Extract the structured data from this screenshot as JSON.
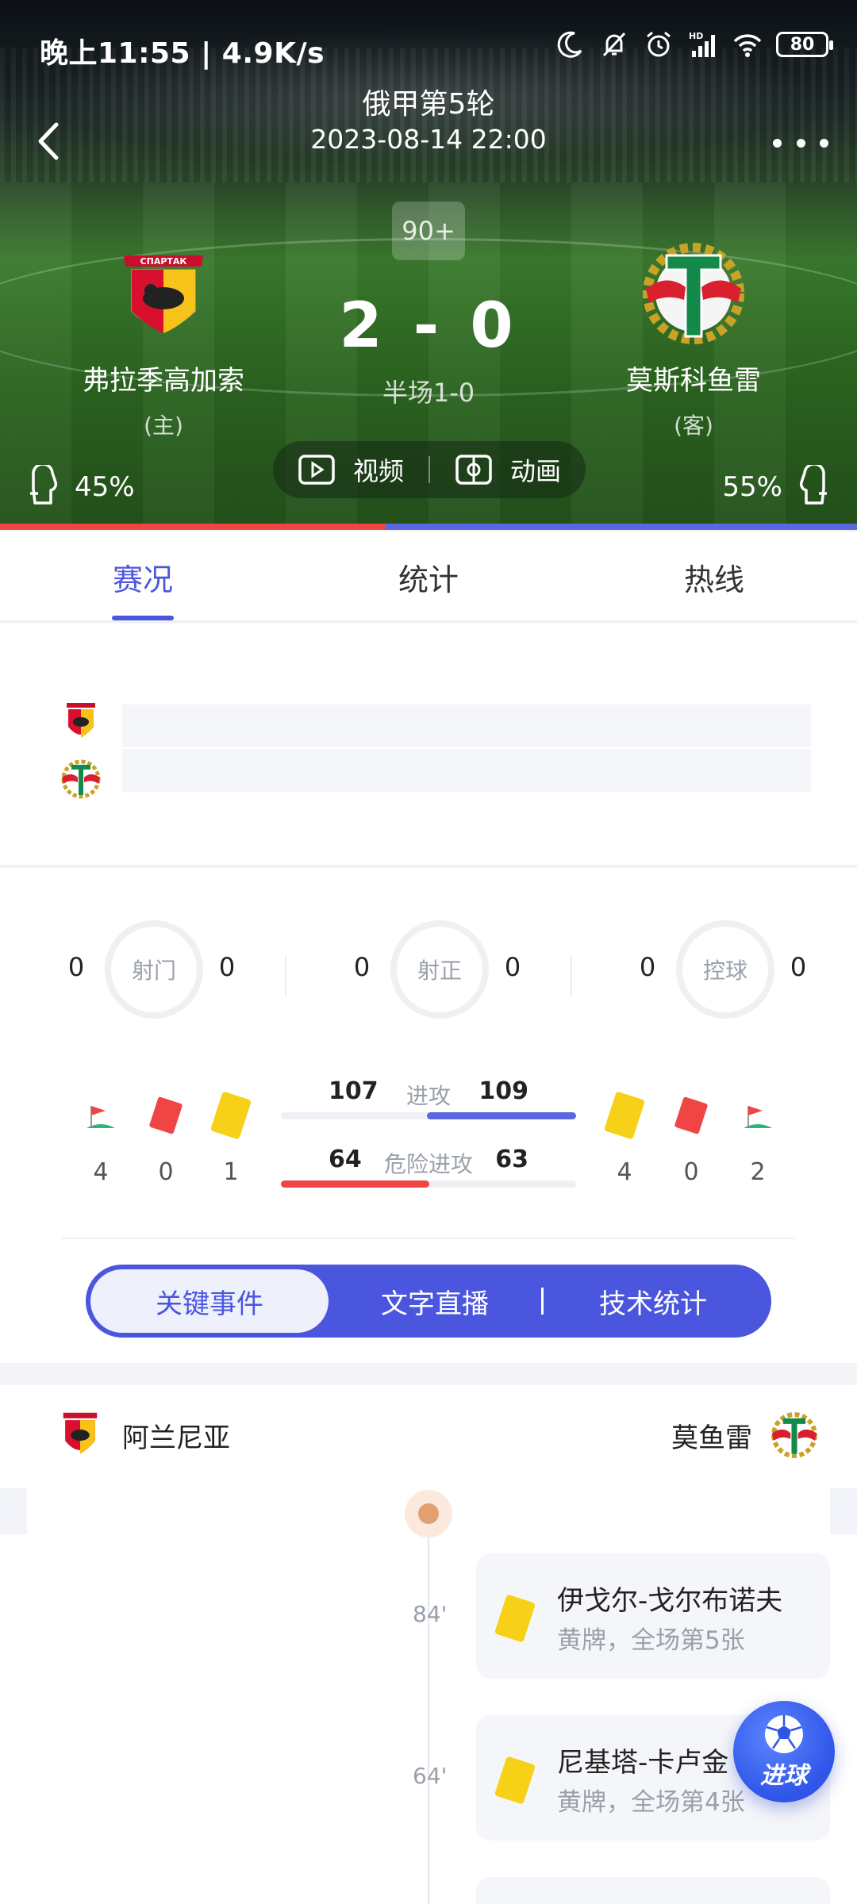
{
  "status_bar": {
    "time": "晚上11:55 | 4.9K/s",
    "battery": "80"
  },
  "header": {
    "league": "俄甲第5轮",
    "datetime": "2023-08-14 22:00"
  },
  "match": {
    "minute": "90+",
    "score": "2 - 0",
    "half_time": "半场1-0",
    "home": {
      "name": "弗拉季高加索",
      "role": "(主)",
      "win_pct": "45%",
      "color": "#ef4545"
    },
    "away": {
      "name": "莫斯科鱼雷",
      "role": "(客)",
      "win_pct": "55%",
      "color": "#5a67e0"
    },
    "home_share": 0.45
  },
  "media": {
    "video": "视频",
    "animation": "动画"
  },
  "tabs": [
    {
      "label": "赛况",
      "active": true
    },
    {
      "label": "统计"
    },
    {
      "label": "热线"
    }
  ],
  "stats": {
    "rings": [
      {
        "label": "射门",
        "home": "0",
        "away": "0"
      },
      {
        "label": "射正",
        "home": "0",
        "away": "0"
      },
      {
        "label": "控球",
        "home": "0",
        "away": "0"
      }
    ],
    "home_counts": {
      "corners": "4",
      "red": "0",
      "yellow": "1"
    },
    "away_counts": {
      "yellow": "4",
      "red": "0",
      "corners": "2"
    },
    "attack": {
      "label": "进攻",
      "home": "107",
      "away": "109"
    },
    "danger": {
      "label": "危险进攻",
      "home": "64",
      "away": "63"
    }
  },
  "segments": {
    "key_events": "关键事件",
    "live_text": "文字直播",
    "tech_stats": "技术统计"
  },
  "events_section": {
    "home_team": "阿兰尼亚",
    "away_team": "莫鱼雷",
    "events": [
      {
        "minute": "84'",
        "player": "伊戈尔-戈尔布诺夫",
        "desc": "黄牌，全场第5张"
      },
      {
        "minute": "64'",
        "player": "尼基塔-卡卢金",
        "desc": "黄牌，全场第4张"
      }
    ]
  },
  "fab": {
    "label": "进球"
  },
  "colors": {
    "accent": "#4b56de",
    "yellow_card": "#f7d117",
    "red_card": "#ef4545"
  }
}
